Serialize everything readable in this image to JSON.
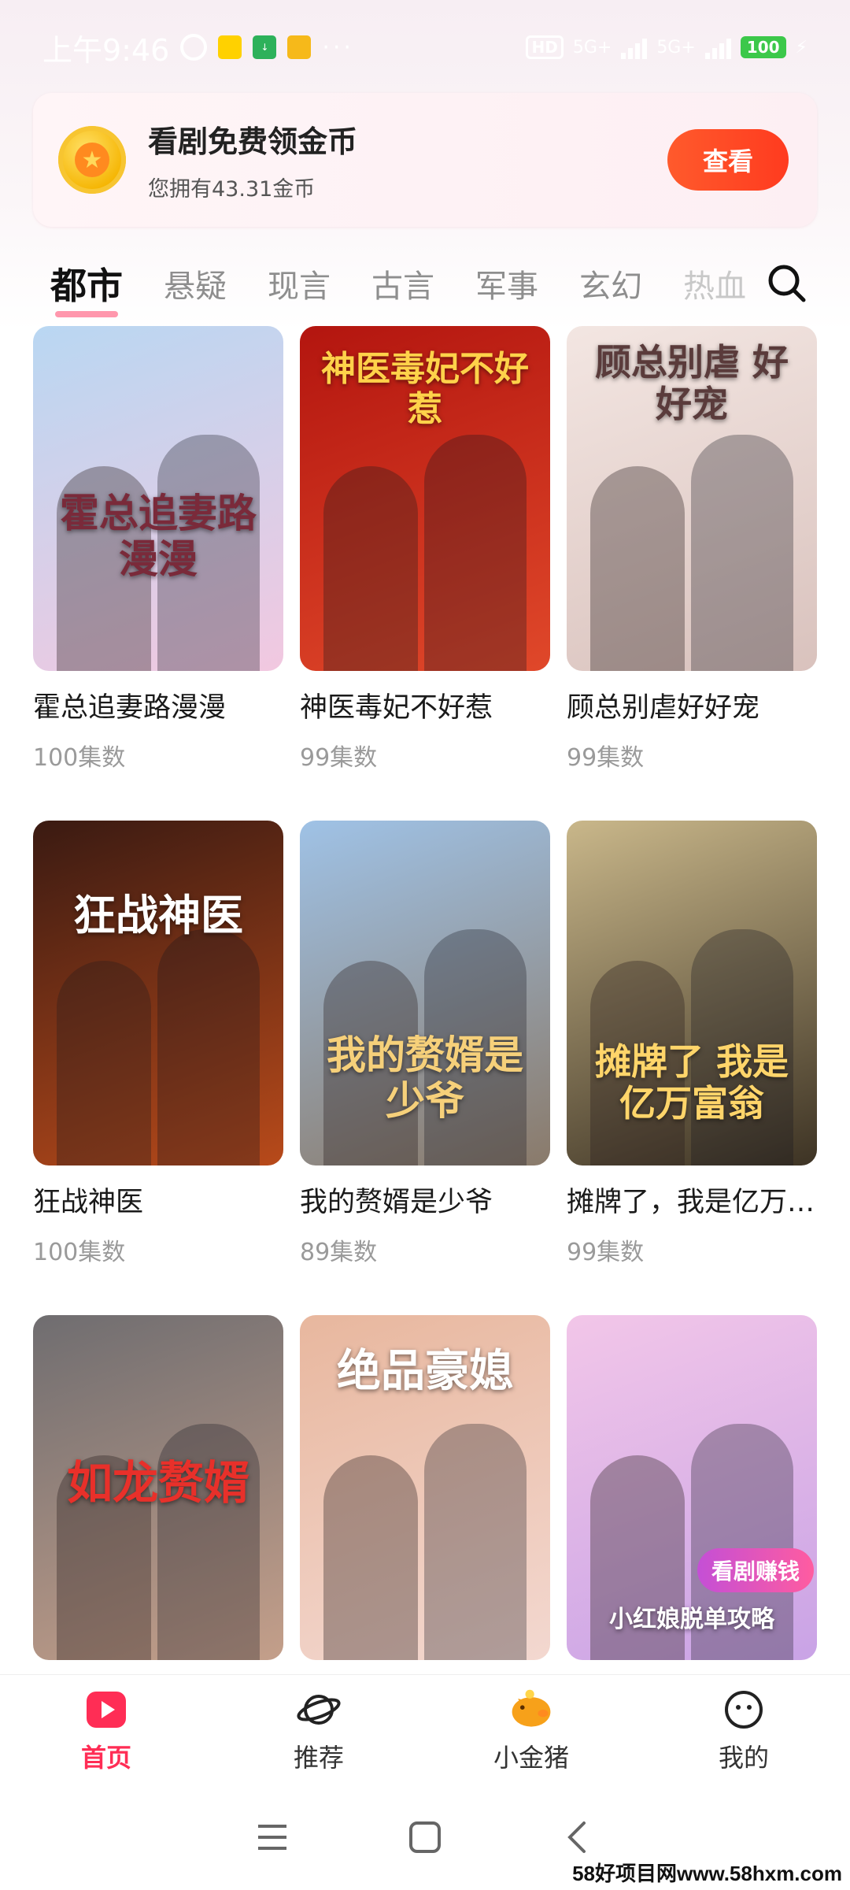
{
  "status_bar": {
    "time": "上午9:46",
    "signal1": "5G+",
    "signal2": "5G+",
    "hd": "HD",
    "battery": "100",
    "more": "···"
  },
  "coin_card": {
    "title": "看剧免费领金币",
    "subtitle": "您拥有43.31金币",
    "button": "查看"
  },
  "tabs": [
    "都市",
    "悬疑",
    "现言",
    "古言",
    "军事",
    "玄幻",
    "热血"
  ],
  "dramas": [
    {
      "title": "霍总追妻路漫漫",
      "episodes": "100集数",
      "poster_text": "霍总追妻路漫漫",
      "bg1": "#b9d7f2",
      "bg2": "#f2c8e0",
      "text_color": "#7a2a3a"
    },
    {
      "title": "神医毒妃不好惹",
      "episodes": "99集数",
      "poster_text": "神医毒妃不好惹",
      "bg1": "#b3150f",
      "bg2": "#e0482a",
      "text_color": "#ffd24a"
    },
    {
      "title": "顾总别虐好好宠",
      "episodes": "99集数",
      "poster_text": "顾总别虐 好好宠",
      "bg1": "#f3e6e2",
      "bg2": "#d9c2bd",
      "text_color": "#5a3b3b"
    },
    {
      "title": "狂战神医",
      "episodes": "100集数",
      "poster_text": "狂战神医",
      "bg1": "#3a1a12",
      "bg2": "#b84a1a",
      "text_color": "#ffffff"
    },
    {
      "title": "我的赘婿是少爷",
      "episodes": "89集数",
      "poster_text": "我的赘婿是少爷",
      "bg1": "#9fc2e6",
      "bg2": "#8a7a6a",
      "text_color": "#f6d07a"
    },
    {
      "title": "摊牌了，我是亿万富翁",
      "episodes": "99集数",
      "poster_text": "摊牌了 我是 亿万富翁",
      "bg1": "#c9b78a",
      "bg2": "#3d3324",
      "text_color": "#ffd56a"
    },
    {
      "title": "",
      "episodes": "",
      "poster_text": "如龙赘婿",
      "bg1": "#6f6d70",
      "bg2": "#c49f8a",
      "text_color": "#e8302a"
    },
    {
      "title": "",
      "episodes": "",
      "poster_text": "绝品豪媳",
      "bg1": "#e8b79e",
      "bg2": "#f3d8d0",
      "text_color": "#ffffff"
    },
    {
      "title": "",
      "episodes": "",
      "poster_text": "小红娘脱单攻略",
      "bg1": "#f2c6e8",
      "bg2": "#c9a3e6",
      "text_color": "#ffffff",
      "badge": "看剧赚钱"
    }
  ],
  "bottom_nav": [
    {
      "label": "首页",
      "icon": "play-icon",
      "active": true
    },
    {
      "label": "推荐",
      "icon": "planet-icon",
      "active": false
    },
    {
      "label": "小金猪",
      "icon": "piggy-icon",
      "active": false
    },
    {
      "label": "我的",
      "icon": "smile-face-icon",
      "active": false
    }
  ],
  "watermark": "58好项目网www.58hxm.com",
  "colors": {
    "accent": "#ff2d55",
    "coin_button": "#ff3b1f"
  }
}
